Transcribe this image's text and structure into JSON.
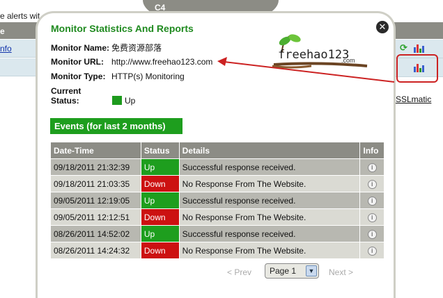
{
  "background": {
    "alerts_text": "e alerts wit",
    "tab_text": "C4",
    "left_header": "e",
    "left_rows": [
      "nfo",
      ""
    ],
    "sslmatic_prefix": "",
    "sslmatic_link": "SSLmatic"
  },
  "modal": {
    "title": "Monitor Statistics And Reports",
    "close_icon": "close-icon",
    "info": {
      "name_label": "Monitor Name:",
      "name_value": "免费资源部落",
      "url_label": "Monitor URL:",
      "url_value": "http://www.freehao123.com",
      "type_label": "Monitor Type:",
      "type_value": "HTTP(s) Monitoring",
      "status_label": "Current Status:",
      "status_value": "Up"
    },
    "logo": {
      "text": "freehao123",
      "sub": ".com"
    },
    "events_title": "Events (for last 2 months)",
    "table": {
      "headers": [
        "Date-Time",
        "Status",
        "Details",
        "Info"
      ],
      "rows": [
        {
          "datetime": "09/18/2011 21:32:39",
          "status": "Up",
          "details": "Successful response received."
        },
        {
          "datetime": "09/18/2011 21:03:35",
          "status": "Down",
          "details": "No Response From The Website."
        },
        {
          "datetime": "09/05/2011 12:19:05",
          "status": "Up",
          "details": "Successful response received."
        },
        {
          "datetime": "09/05/2011 12:12:51",
          "status": "Down",
          "details": "No Response From The Website."
        },
        {
          "datetime": "08/26/2011 14:52:02",
          "status": "Up",
          "details": "Successful response received."
        },
        {
          "datetime": "08/26/2011 14:24:32",
          "status": "Down",
          "details": "No Response From The Website."
        }
      ]
    },
    "pager": {
      "prev": "< Prev",
      "page_value": "Page 1",
      "next": "Next >"
    }
  },
  "colors": {
    "accent_green": "#1e9e1e",
    "down_red": "#cc1111",
    "header_gray": "#8c8c85",
    "arrow_red": "#cc2222"
  }
}
